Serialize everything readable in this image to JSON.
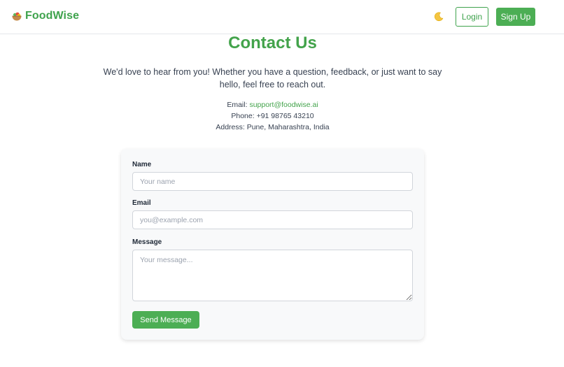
{
  "navbar": {
    "brand_name": "FoodWise",
    "brand_icon": "salad-bowl-icon",
    "theme_icon": "moon-icon",
    "login_label": "Login",
    "signup_label": "Sign Up"
  },
  "page": {
    "title": "Contact Us",
    "intro": "We'd love to hear from you! Whether you have a question, feedback, or just want to say hello, feel free to reach out."
  },
  "contact": {
    "email_label": "Email:",
    "email_value": "support@foodwise.ai",
    "phone_label": "Phone:",
    "phone_value": "+91 98765 43210",
    "address_label": "Address:",
    "address_value": "Pune, Maharashtra, India"
  },
  "form": {
    "name_label": "Name",
    "name_placeholder": "Your name",
    "email_label": "Email",
    "email_placeholder": "you@example.com",
    "message_label": "Message",
    "message_placeholder": "Your message...",
    "submit_label": "Send Message"
  },
  "colors": {
    "brand_green": "#43a34b",
    "button_green": "#4cae54"
  }
}
